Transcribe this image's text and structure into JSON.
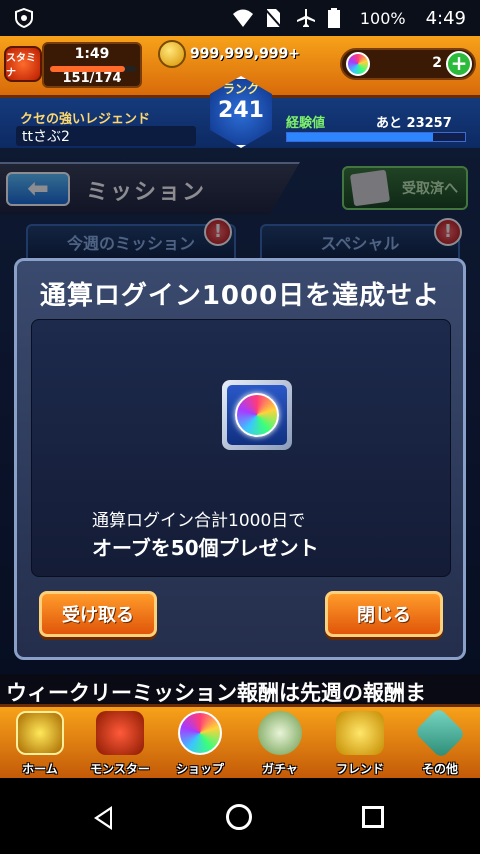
{
  "statusbar": {
    "battery": "100%",
    "time": "4:49"
  },
  "header": {
    "stamina_label": "スタミナ",
    "stamina_time": "1:49",
    "stamina_value": "151/174",
    "stamina_fraction": 0.868,
    "coins": "999,999,999+",
    "orbs": "2",
    "rank_label": "ランク",
    "rank_value": "241",
    "title": "クセの強いレジェンド",
    "username": "ttさぶ2",
    "exp_label": "経験値",
    "exp_remaining": "あと 23257",
    "exp_fraction": 0.82
  },
  "page": {
    "title": "ミッション",
    "received_button": "受取済へ",
    "tabs": [
      "今週のミッション",
      "スペシャル"
    ]
  },
  "modal": {
    "title": "通算ログイン1000日を達成せよ",
    "desc_line1": "通算ログイン合計1000日で",
    "desc_line2": "オーブを50個プレゼント",
    "receive_button": "受け取る",
    "close_button": "閉じる"
  },
  "ticker": "ウィークリーミッション報酬は先週の報酬ま",
  "nav": [
    "ホーム",
    "モンスター",
    "ショップ",
    "ガチャ",
    "フレンド",
    "その他"
  ]
}
